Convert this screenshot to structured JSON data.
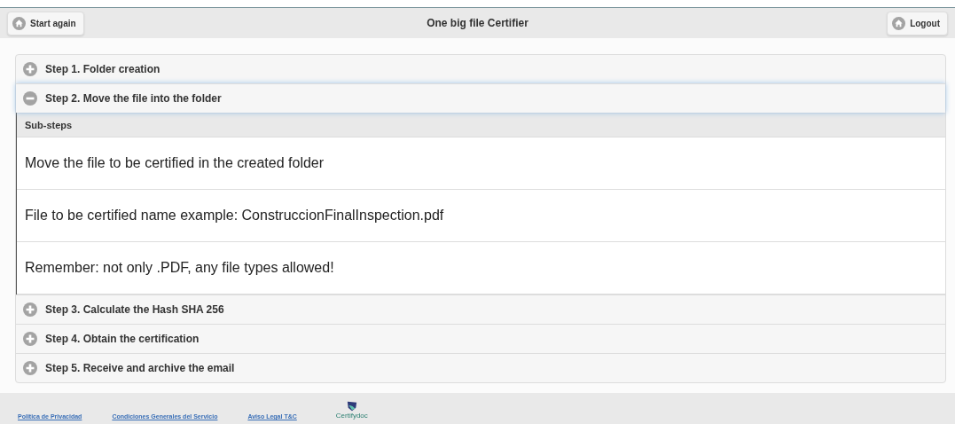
{
  "header": {
    "title": "One big file Certifier",
    "left_button": "Start again",
    "right_button": "Logout"
  },
  "steps": [
    {
      "label": "Step 1. Folder creation",
      "expanded": false
    },
    {
      "label": "Step 2. Move the file into the folder",
      "expanded": true,
      "section": "Sub-steps",
      "items": [
        "Move the file to be certified in the created folder",
        "File to be certified name example: ConstruccionFinalInspection.pdf",
        "Remember: not only .PDF, any file types allowed!"
      ]
    },
    {
      "label": "Step 3. Calculate the Hash SHA 256",
      "expanded": false
    },
    {
      "label": "Step 4. Obtain the certification",
      "expanded": false
    },
    {
      "label": "Step 5. Receive and archive the email",
      "expanded": false
    }
  ],
  "footer": {
    "links": [
      "Politica de Privacidad",
      "Condiciones Generales del Servicio",
      "Aviso Legal T&C"
    ],
    "logo_text": "Certifydoc"
  }
}
